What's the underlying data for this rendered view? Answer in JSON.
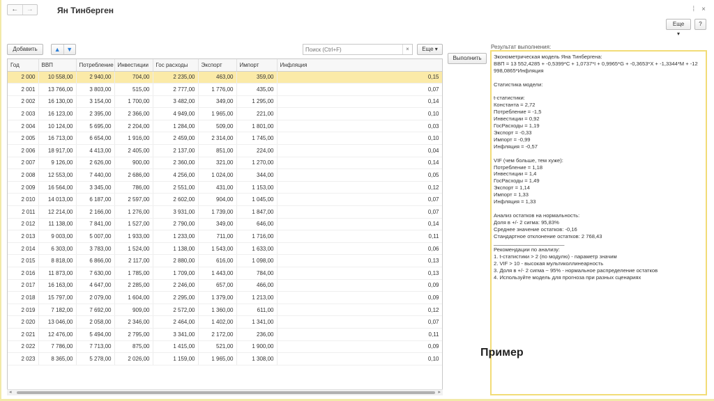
{
  "window": {
    "title": "Ян Тинберген",
    "more_label": "Еще",
    "help_label": "?",
    "link_glyph": "⁞",
    "close_glyph": "×",
    "nav_back": "←",
    "nav_forward": "→"
  },
  "toolbar": {
    "add_label": "Добавить",
    "up_glyph": "▲",
    "down_glyph": "▼",
    "search_placeholder": "Поиск (Ctrl+F)",
    "clear_glyph": "×",
    "more_label": "Еще",
    "execute_label": "Выполнить"
  },
  "table": {
    "columns": [
      "Год",
      "ВВП",
      "Потребление",
      "Инвестиции",
      "Гос расходы",
      "Экспорт",
      "Импорт",
      "Инфляция"
    ],
    "rows": [
      [
        "2 000",
        "10 558,00",
        "2 940,00",
        "704,00",
        "2 235,00",
        "463,00",
        "359,00",
        "0,15"
      ],
      [
        "2 001",
        "13 766,00",
        "3 803,00",
        "515,00",
        "2 777,00",
        "1 776,00",
        "435,00",
        "0,07"
      ],
      [
        "2 002",
        "16 130,00",
        "3 154,00",
        "1 700,00",
        "3 482,00",
        "349,00",
        "1 295,00",
        "0,14"
      ],
      [
        "2 003",
        "16 123,00",
        "2 395,00",
        "2 366,00",
        "4 949,00",
        "1 965,00",
        "221,00",
        "0,10"
      ],
      [
        "2 004",
        "10 124,00",
        "5 695,00",
        "2 204,00",
        "1 284,00",
        "509,00",
        "1 801,00",
        "0,03"
      ],
      [
        "2 005",
        "16 713,00",
        "6 654,00",
        "1 916,00",
        "2 459,00",
        "2 314,00",
        "1 745,00",
        "0,10"
      ],
      [
        "2 006",
        "18 917,00",
        "4 413,00",
        "2 405,00",
        "2 137,00",
        "851,00",
        "224,00",
        "0,04"
      ],
      [
        "2 007",
        "9 126,00",
        "2 626,00",
        "900,00",
        "2 360,00",
        "321,00",
        "1 270,00",
        "0,14"
      ],
      [
        "2 008",
        "12 553,00",
        "7 440,00",
        "2 686,00",
        "4 256,00",
        "1 024,00",
        "344,00",
        "0,05"
      ],
      [
        "2 009",
        "16 564,00",
        "3 345,00",
        "786,00",
        "2 551,00",
        "431,00",
        "1 153,00",
        "0,12"
      ],
      [
        "2 010",
        "14 013,00",
        "6 187,00",
        "2 597,00",
        "2 602,00",
        "904,00",
        "1 045,00",
        "0,07"
      ],
      [
        "2 011",
        "12 214,00",
        "2 166,00",
        "1 276,00",
        "3 931,00",
        "1 739,00",
        "1 847,00",
        "0,07"
      ],
      [
        "2 012",
        "11 138,00",
        "7 841,00",
        "1 527,00",
        "2 790,00",
        "349,00",
        "646,00",
        "0,14"
      ],
      [
        "2 013",
        "9 003,00",
        "5 007,00",
        "1 933,00",
        "1 233,00",
        "711,00",
        "1 716,00",
        "0,11"
      ],
      [
        "2 014",
        "6 303,00",
        "3 783,00",
        "1 524,00",
        "1 138,00",
        "1 543,00",
        "1 633,00",
        "0,06"
      ],
      [
        "2 015",
        "8 818,00",
        "6 866,00",
        "2 117,00",
        "2 880,00",
        "616,00",
        "1 098,00",
        "0,13"
      ],
      [
        "2 016",
        "11 873,00",
        "7 630,00",
        "1 785,00",
        "1 709,00",
        "1 443,00",
        "784,00",
        "0,13"
      ],
      [
        "2 017",
        "16 163,00",
        "4 647,00",
        "2 285,00",
        "2 246,00",
        "657,00",
        "466,00",
        "0,09"
      ],
      [
        "2 018",
        "15 797,00",
        "2 079,00",
        "1 604,00",
        "2 295,00",
        "1 379,00",
        "1 213,00",
        "0,09"
      ],
      [
        "2 019",
        "7 182,00",
        "7 692,00",
        "909,00",
        "2 572,00",
        "1 360,00",
        "611,00",
        "0,12"
      ],
      [
        "2 020",
        "13 046,00",
        "2 058,00",
        "2 346,00",
        "2 464,00",
        "1 402,00",
        "1 341,00",
        "0,07"
      ],
      [
        "2 021",
        "12 476,00",
        "5 494,00",
        "2 795,00",
        "3 341,00",
        "2 172,00",
        "236,00",
        "0,11"
      ],
      [
        "2 022",
        "7 786,00",
        "7 713,00",
        "875,00",
        "1 415,00",
        "521,00",
        "1 900,00",
        "0,09"
      ],
      [
        "2 023",
        "8 365,00",
        "5 278,00",
        "2 026,00",
        "1 159,00",
        "1 965,00",
        "1 308,00",
        "0,10"
      ]
    ]
  },
  "result": {
    "label": "Результат выполнения:",
    "text": "Эконометрическая модель Яна Тинбергена:\nВВП = 13 552,4285 + -0,5399*C + 1,0737*I + 0,9965*G + -0,3653*X + -1,3344*M + -12 998,0865*Инфляция\n\nСтатистика модели:\n\nt-статистики:\nКонстанта = 2,72\nПотребление = -1,5\nИнвестиции = 0,92\nГосРасходы = 1,19\nЭкспорт = -0,33\nИмпорт = -0,99\nИнфляция = -0,57\n\nVIF (чем больше, тем хуже):\nПотребление = 1,18\nИнвестиции = 1,4\nГосРасходы = 1,49\nЭкспорт = 1,14\nИмпорт = 1,33\nИнфляция = 1,33\n\nАнализ остатков на нормальность:\nДоля в +/- 2 сигма: 95,83%\nСреднее значение остатков: -0,16\nСтандартное отклонение остатков: 2 768,43\n________________________\nРекомендации по анализу:\n1. t-статистики > 2 (по модулю) - параметр значим\n2. VIF > 10 - высокая мультиколлинеарность\n3. Доля в +/- 2 сигма ~ 95% - нормальное распределение остатков\n4. Используйте модель для прогноза при разных сценариях"
  },
  "overlay": {
    "example_label": "Пример"
  }
}
